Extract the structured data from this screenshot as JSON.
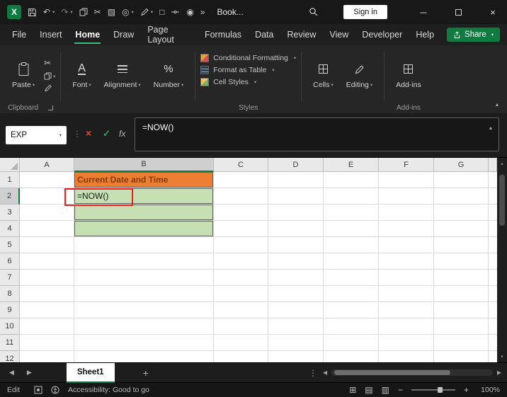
{
  "colors": {
    "excel_green": "#107C41",
    "tab_underline_green": "#33C481",
    "cell_fill_orange": "#ED7D31",
    "cell_fill_green": "#C6E0B4",
    "cell_text_brown": "#833C00",
    "annotation_red": "#EE1C1C"
  },
  "icons": {
    "excel_logo": "X",
    "undo": "↶",
    "redo": "↷",
    "cut": "✂",
    "picture": "▨",
    "zoom": "◎",
    "document": "□",
    "camera": "◉",
    "more": "»",
    "minimize": "─",
    "close": "×",
    "check": "✓",
    "dropdown": "▾",
    "collapse": "▴",
    "font": "A",
    "number": "%",
    "view_normal": "⊞",
    "view_layout": "▤",
    "view_break": "▥",
    "more_dots": "⋮",
    "tab_nav_left": "◀",
    "tab_nav_right": "▶",
    "add_sheet": "+",
    "zoom_out": "−",
    "zoom_in": "+",
    "scroll_left": "◀",
    "scroll_right": "▶",
    "scroll_up": "▴",
    "scroll_down": "▾"
  },
  "titlebar": {
    "workbook_name": "Book...",
    "sign_in": "Sign in"
  },
  "menubar": {
    "items": [
      "File",
      "Insert",
      "Home",
      "Draw",
      "Page Layout",
      "Formulas",
      "Data",
      "Review",
      "View",
      "Developer",
      "Help"
    ],
    "active_item": "Home",
    "share": "Share"
  },
  "ribbon": {
    "paste": "Paste",
    "font": "Font",
    "alignment": "Alignment",
    "number": "Number",
    "styles_items": [
      "Conditional Formatting",
      "Format as Table",
      "Cell Styles"
    ],
    "cells": "Cells",
    "editing": "Editing",
    "addins": "Add-ins",
    "group_clipboard": "Clipboard",
    "group_styles": "Styles",
    "group_addins": "Add-ins"
  },
  "formula_bar": {
    "name_box": "EXP",
    "fx_label": "fx",
    "formula": "=NOW()"
  },
  "grid": {
    "columns": [
      "A",
      "B",
      "C",
      "D",
      "E",
      "F",
      "G"
    ],
    "rows": [
      "1",
      "2",
      "3",
      "4",
      "5",
      "6",
      "7",
      "8",
      "9",
      "10",
      "11",
      "12"
    ],
    "selected_column": "B",
    "selected_row": "2",
    "bordered_range": [
      "B1",
      "B2",
      "B3",
      "B4"
    ],
    "cells": {
      "B1": {
        "text": "Current Date and Time",
        "bg": "#ED7D31",
        "color": "#833C00",
        "bold": true
      },
      "B2": {
        "text": "=NOW()",
        "bg": "#C6E0B4",
        "color": "#1a1a1a"
      },
      "B3": {
        "bg": "#C6E0B4"
      },
      "B4": {
        "bg": "#C6E0B4"
      }
    }
  },
  "sheet_bar": {
    "active_tab": "Sheet1"
  },
  "status_bar": {
    "mode": "Edit",
    "accessibility": "Accessibility: Good to go",
    "zoom": "100%"
  }
}
